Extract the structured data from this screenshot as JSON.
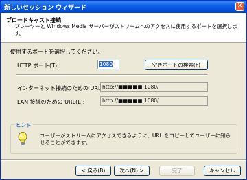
{
  "window": {
    "title": "新しいセッション ウィザード",
    "close_glyph": "✕"
  },
  "header": {
    "title": "ブロードキャスト接続",
    "description": "プレーヤーと Windows Media サーバーがストリームへのアクセスに使用するポートを選択します。"
  },
  "body": {
    "instruction": "使用するポートを選択してください。",
    "http_port_label": "HTTP ポート(T):",
    "http_port_value": "1080",
    "find_port_button": "空きポートの検索(F)",
    "internet_url_label": "インターネット接続のための URL(I):",
    "internet_url_value": "http://■■■■■:1080/",
    "lan_url_label": "LAN 接続のための URL(L):",
    "lan_url_value": "http://■■■■■:1080/"
  },
  "hint": {
    "legend": "ヒント",
    "icon": "lightbulb-icon",
    "text": "ユーザーがストリームにアクセスできるように、URL をコピーしてユーザーに知らせることができます。"
  },
  "footer": {
    "back_button": "< 戻る(B)",
    "next_button": "次へ(N) >",
    "finish_button": "完了",
    "cancel_button": "キャンセル"
  },
  "colors": {
    "titlebar": "#0a5fe6",
    "dialog": "#ece9d8",
    "hint_legend": "#0046d5",
    "selection": "#316ac5"
  }
}
